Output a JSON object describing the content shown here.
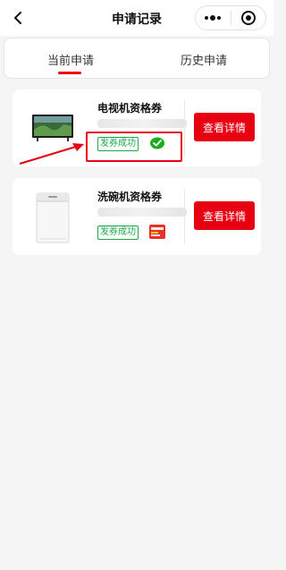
{
  "nav": {
    "title": "申请记录",
    "back_icon": "chevron-left-icon",
    "more_icon": "more-dots-icon",
    "close_icon": "target-circle-icon"
  },
  "tabs": [
    {
      "label": "当前申请",
      "active": true
    },
    {
      "label": "历史申请",
      "active": false
    }
  ],
  "records": [
    {
      "product_name": "电视机资格券",
      "status": "发券成功",
      "product_icon": "tv-image-icon",
      "payment_icon": "wechat-pay-icon",
      "detail_button": "查看详情"
    },
    {
      "product_name": "洗碗机资格券",
      "status": "发券成功",
      "product_icon": "dishwasher-image-icon",
      "payment_icon": "unionpay-icon",
      "detail_button": "查看详情"
    }
  ],
  "colors": {
    "accent_red": "#e60012",
    "success_green": "#1aa74a",
    "background": "#f5f5f5"
  }
}
